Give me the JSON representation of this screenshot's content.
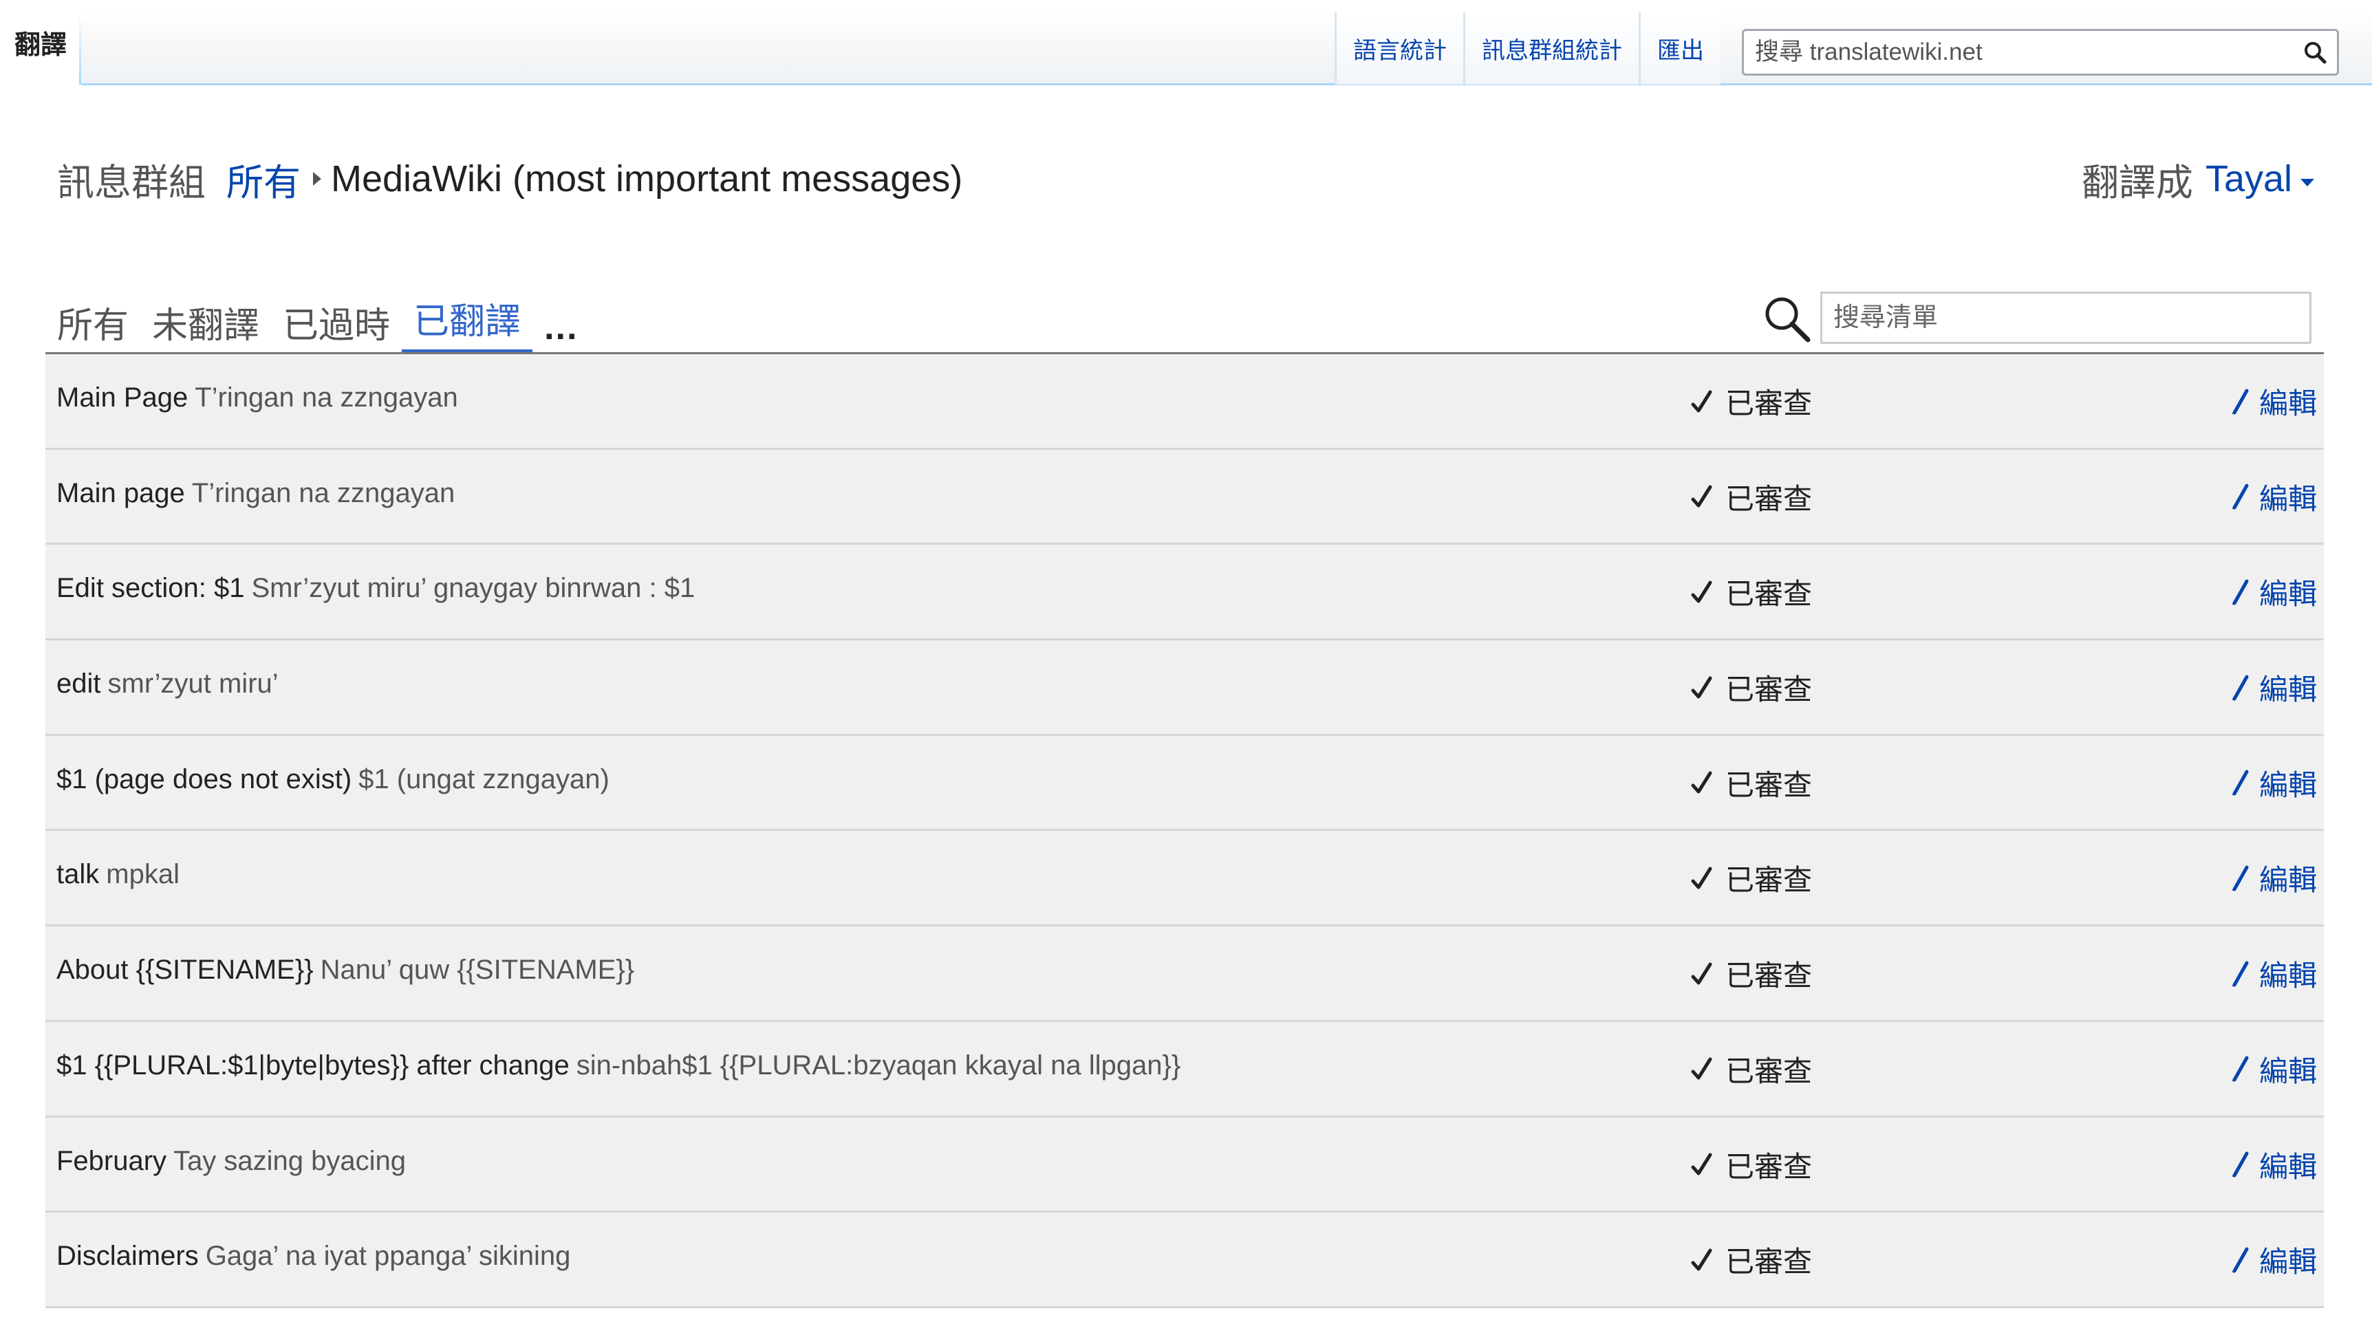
{
  "top_nav": {
    "active_tab": "翻譯",
    "links": [
      "語言統計",
      "訊息群組統計",
      "匯出"
    ],
    "search_placeholder": "搜尋 translatewiki.net"
  },
  "header": {
    "breadcrumb_label": "訊息群組",
    "breadcrumb_all": "所有",
    "group_name": "MediaWiki (most important messages)",
    "translate_to_label": "翻譯成",
    "language": "Tayal"
  },
  "filters": {
    "tabs": [
      "所有",
      "未翻譯",
      "已過時",
      "已翻譯",
      "..."
    ],
    "active": "已翻譯",
    "search_placeholder": "搜尋清單"
  },
  "messages": [
    {
      "source": "Main Page",
      "translation": "T’ringan na zzngayan",
      "status": "已審查",
      "action": "編輯"
    },
    {
      "source": "Main page",
      "translation": "T’ringan na zzngayan",
      "status": "已審查",
      "action": "編輯"
    },
    {
      "source": "Edit section: $1",
      "translation": "Smr’zyut miru’ gnaygay binrwan : $1",
      "status": "已審查",
      "action": "編輯"
    },
    {
      "source": "edit",
      "translation": "smr’zyut miru’",
      "status": "已審查",
      "action": "編輯"
    },
    {
      "source": "$1 (page does not exist)",
      "translation": "$1 (ungat zzngayan)",
      "status": "已審查",
      "action": "編輯"
    },
    {
      "source": "talk",
      "translation": "mpkal",
      "status": "已審查",
      "action": "編輯"
    },
    {
      "source": "About {{SITENAME}}",
      "translation": "Nanu’ quw {{SITENAME}}",
      "status": "已審查",
      "action": "編輯"
    },
    {
      "source": "$1 {{PLURAL:$1|byte|bytes}} after change",
      "translation": "sin-nbah$1 {{PLURAL:bzyaqan kkayal na llpgan}}",
      "status": "已審查",
      "action": "編輯"
    },
    {
      "source": "February",
      "translation": "Tay sazing byacing",
      "status": "已審查",
      "action": "編輯"
    },
    {
      "source": "Disclaimers",
      "translation": "Gaga’ na iyat ppanga’ sikining",
      "status": "已審查",
      "action": "編輯"
    }
  ],
  "colors": {
    "link": "#0645ad",
    "active_tab": "#3366cc",
    "row_bg": "#f0f0f0"
  }
}
